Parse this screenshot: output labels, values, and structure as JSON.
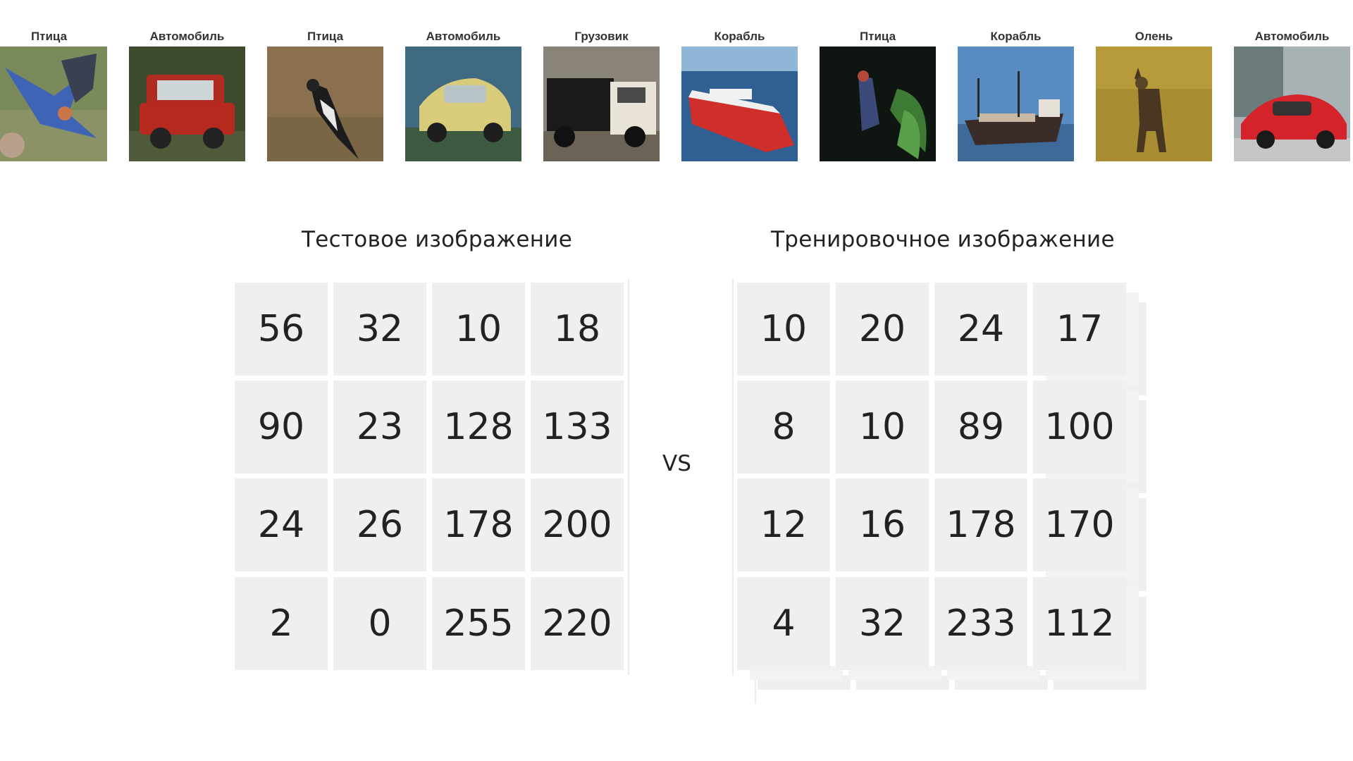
{
  "thumbnails": [
    {
      "label": "Птица",
      "image": "bird-photo"
    },
    {
      "label": "Автомобиль",
      "image": "red-car-photo"
    },
    {
      "label": "Птица",
      "image": "magpie-photo"
    },
    {
      "label": "Автомобиль",
      "image": "yellow-car-photo"
    },
    {
      "label": "Грузовик",
      "image": "truck-photo"
    },
    {
      "label": "Корабль",
      "image": "red-ship-photo"
    },
    {
      "label": "Птица",
      "image": "dark-bird-photo"
    },
    {
      "label": "Корабль",
      "image": "cargo-ship-photo"
    },
    {
      "label": "Олень",
      "image": "deer-photo"
    },
    {
      "label": "Автомобиль",
      "image": "red-coupe-photo"
    }
  ],
  "test_grid": {
    "title": "Тестовое изображение",
    "values": [
      [
        "56",
        "32",
        "10",
        "18"
      ],
      [
        "90",
        "23",
        "128",
        "133"
      ],
      [
        "24",
        "26",
        "178",
        "200"
      ],
      [
        "2",
        "0",
        "255",
        "220"
      ]
    ]
  },
  "vs_label": "VS",
  "train_grid": {
    "title": "Тренировочное изображение",
    "values": [
      [
        "10",
        "20",
        "24",
        "17"
      ],
      [
        "8",
        "10",
        "89",
        "100"
      ],
      [
        "12",
        "16",
        "178",
        "170"
      ],
      [
        "4",
        "32",
        "233",
        "112"
      ]
    ]
  },
  "colors": {
    "cell_background": "#efefef",
    "text": "#222222"
  }
}
